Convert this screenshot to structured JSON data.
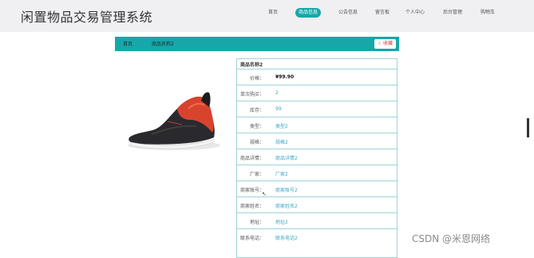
{
  "header": {
    "site_title": "闲置物品交易管理系统",
    "nav": [
      "首页",
      "商品信息",
      "公告信息",
      "留言板",
      "个人中心",
      "后台管理",
      "购物车"
    ],
    "active_nav": "商品信息"
  },
  "breadcrumb": {
    "home": "首页",
    "current": "商品名称2"
  },
  "favorite_button": "☆ 收藏",
  "product": {
    "title": "商品名称2",
    "rows": [
      {
        "k": "价格：",
        "v": "¥99.90"
      },
      {
        "k": "单次购买：",
        "v": "2"
      },
      {
        "k": "库存：",
        "v": "99"
      },
      {
        "k": "类型：",
        "v": "类型2"
      },
      {
        "k": "规格：",
        "v": "规格2"
      },
      {
        "k": "商品详情：",
        "v": "商品详情2"
      },
      {
        "k": "厂家：",
        "v": "厂家2"
      },
      {
        "k": "商家账号：",
        "v": "商家账号2"
      },
      {
        "k": "商家姓名：",
        "v": "商家姓名2"
      },
      {
        "k": "地址：",
        "v": "地址2"
      },
      {
        "k": "联系电话：",
        "v": "联系电话2"
      }
    ]
  },
  "watermark": "CSDN @米恩网络",
  "colors": {
    "accent": "#16a7a9",
    "link": "#3aa7c8"
  }
}
